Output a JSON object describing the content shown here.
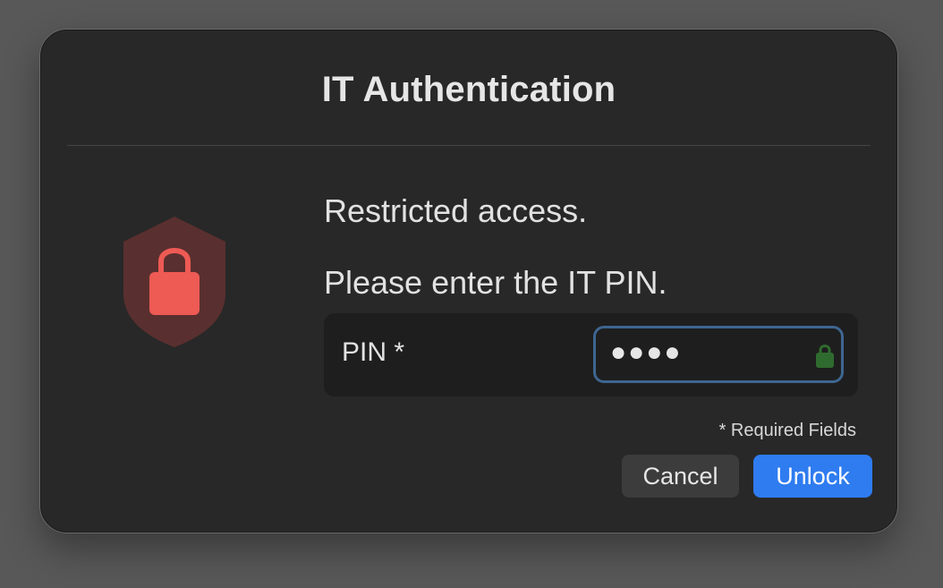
{
  "dialog": {
    "title": "IT Authentication",
    "message_line1": "Restricted access.",
    "message_line2": "Please enter the IT PIN.",
    "pin_label": "PIN *",
    "pin_value": "●●●●",
    "required_note": "* Required Fields",
    "cancel_label": "Cancel",
    "unlock_label": "Unlock"
  },
  "icons": {
    "shield": "shield-lock-icon",
    "field_lock": "lock-icon"
  },
  "colors": {
    "shield_fill": "#5a2f2f",
    "lock_fill": "#ee5a54",
    "field_lock_fill": "#2f6b2f",
    "accent": "#2f7cf0",
    "focus_ring": "#3e6690"
  }
}
